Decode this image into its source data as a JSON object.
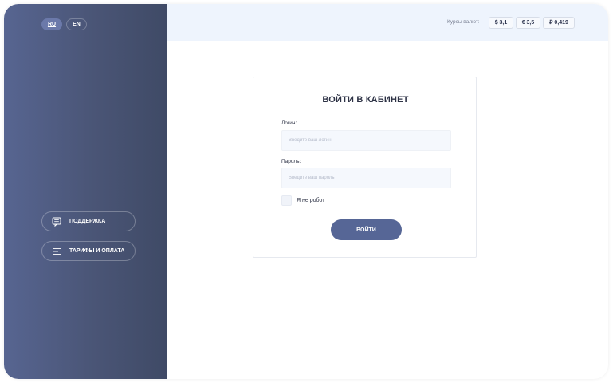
{
  "sidebar": {
    "languages": {
      "ru": "RU",
      "en": "EN",
      "active": "RU"
    },
    "support_label": "ПОДДЕРЖКА",
    "tariffs_label": "ТАРИФЫ И ОПЛАТА"
  },
  "header": {
    "rates_label": "Курсы валют:",
    "rates": {
      "usd": "$ 3,1",
      "eur": "€ 3,5",
      "rub": "₽ 0,419"
    }
  },
  "login": {
    "title": "ВОЙТИ В КАБИНЕТ",
    "login_label": "Логин:",
    "login_placeholder": "Введите ваш логин",
    "password_label": "Пароль:",
    "password_placeholder": "Введите ваш пароль",
    "robot_label": "Я не робот",
    "submit_label": "ВОЙТИ"
  },
  "colors": {
    "sidebar": "#4a5576",
    "accent": "#566696",
    "topbar": "#eef4fd"
  }
}
